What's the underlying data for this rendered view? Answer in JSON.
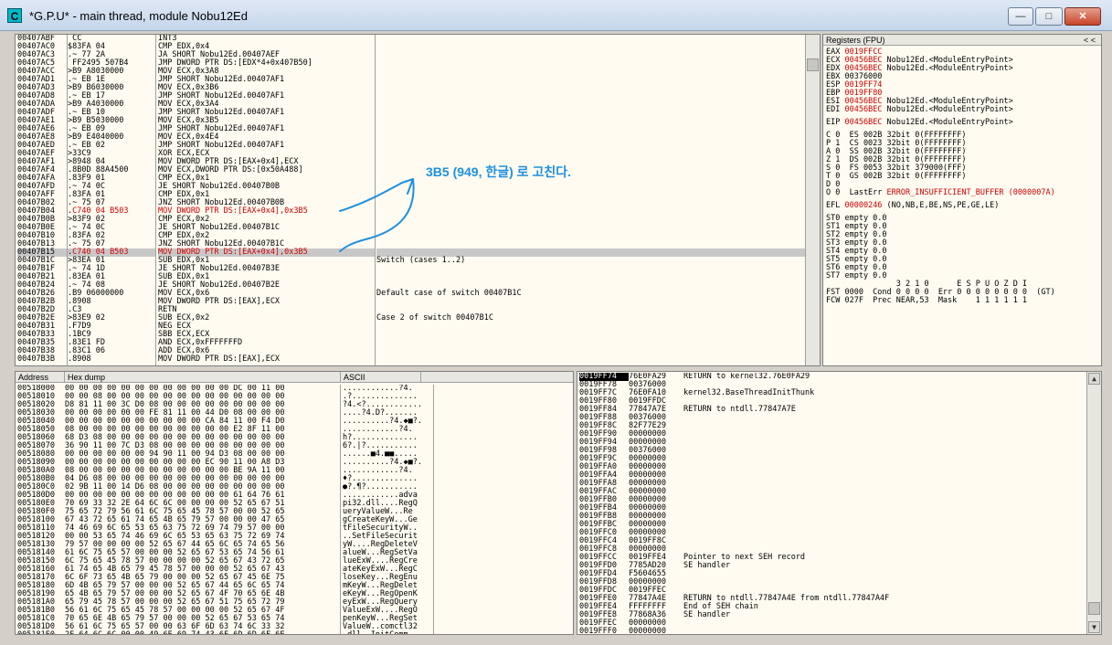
{
  "window": {
    "title": "*G.P.U* - main thread, module Nobu12Ed",
    "icon_letter": "C",
    "controls": {
      "minimize": "—",
      "maximize": "□",
      "close": "✕"
    }
  },
  "annotation": {
    "text": "3B5 (949, 한글) 로 고친다.",
    "color": "#1e90e0"
  },
  "cpu": {
    "selected_row": 26,
    "rows": [
      {
        "a": "00407ABF",
        "m": " ",
        "h": "CC",
        "i": "INT3",
        "c": ""
      },
      {
        "a": "00407AC0",
        "m": "$",
        "h": "83FA 04",
        "i": "CMP EDX,0x4",
        "c": ""
      },
      {
        "a": "00407AC3",
        "m": ".",
        "h": "~ 77 2A",
        "i": "JA SHORT Nobu12Ed.00407AEF",
        "c": ""
      },
      {
        "a": "00407AC5",
        "m": " ",
        "h": "FF2495 507B4",
        "i": "JMP DWORD PTR DS:[EDX*4+0x407B50]",
        "c": ""
      },
      {
        "a": "00407ACC",
        "m": ">",
        "h": "B9 A8030000",
        "i": "MOV ECX,0x3A8",
        "c": ""
      },
      {
        "a": "00407AD1",
        "m": ".",
        "h": "~ EB 1E",
        "i": "JMP SHORT Nobu12Ed.00407AF1",
        "c": ""
      },
      {
        "a": "00407AD3",
        "m": ">",
        "h": "B9 B6030000",
        "i": "MOV ECX,0x3B6",
        "c": ""
      },
      {
        "a": "00407AD8",
        "m": ".",
        "h": "~ EB 17",
        "i": "JMP SHORT Nobu12Ed.00407AF1",
        "c": ""
      },
      {
        "a": "00407ADA",
        "m": ">",
        "h": "B9 A4030000",
        "i": "MOV ECX,0x3A4",
        "c": ""
      },
      {
        "a": "00407ADF",
        "m": ".",
        "h": "~ EB 10",
        "i": "JMP SHORT Nobu12Ed.00407AF1",
        "c": ""
      },
      {
        "a": "00407AE1",
        "m": ">",
        "h": "B9 B5030000",
        "i": "MOV ECX,0x3B5",
        "c": ""
      },
      {
        "a": "00407AE6",
        "m": ".",
        "h": "~ EB 09",
        "i": "JMP SHORT Nobu12Ed.00407AF1",
        "c": ""
      },
      {
        "a": "00407AE8",
        "m": ">",
        "h": "B9 E4040000",
        "i": "MOV ECX,0x4E4",
        "c": ""
      },
      {
        "a": "00407AED",
        "m": ".",
        "h": "~ EB 02",
        "i": "JMP SHORT Nobu12Ed.00407AF1",
        "c": ""
      },
      {
        "a": "00407AEF",
        "m": ">",
        "h": "33C9",
        "i": "XOR ECX,ECX",
        "c": ""
      },
      {
        "a": "00407AF1",
        "m": ">",
        "h": "8948 04",
        "i": "MOV DWORD PTR DS:[EAX+0x4],ECX",
        "c": ""
      },
      {
        "a": "00407AF4",
        "m": ".",
        "h": "8B0D 88A4500",
        "i": "MOV ECX,DWORD PTR DS:[0x50A488]",
        "c": ""
      },
      {
        "a": "00407AFA",
        "m": ".",
        "h": "83F9 01",
        "i": "CMP ECX,0x1",
        "c": ""
      },
      {
        "a": "00407AFD",
        "m": ".",
        "h": "~ 74 0C",
        "i": "JE SHORT Nobu12Ed.00407B0B",
        "c": ""
      },
      {
        "a": "00407AFF",
        "m": ".",
        "h": "83FA 01",
        "i": "CMP EDX,0x1",
        "c": ""
      },
      {
        "a": "00407B02",
        "m": ".",
        "h": "~ 75 07",
        "i": "JNZ SHORT Nobu12Ed.00407B0B",
        "c": ""
      },
      {
        "a": "00407B04",
        "m": ".",
        "h": "C740 04 B503",
        "i": "MOV DWORD PTR DS:[EAX+0x4],0x3B5",
        "c": "",
        "red": true
      },
      {
        "a": "00407B0B",
        "m": ">",
        "h": "83F9 02",
        "i": "CMP ECX,0x2",
        "c": ""
      },
      {
        "a": "00407B0E",
        "m": ".",
        "h": "~ 74 0C",
        "i": "JE SHORT Nobu12Ed.00407B1C",
        "c": ""
      },
      {
        "a": "00407B10",
        "m": ".",
        "h": "83FA 02",
        "i": "CMP EDX,0x2",
        "c": ""
      },
      {
        "a": "00407B13",
        "m": ".",
        "h": "~ 75 07",
        "i": "JNZ SHORT Nobu12Ed.00407B1C",
        "c": ""
      },
      {
        "a": "00407B15",
        "m": ".",
        "h": "C740 04 B503",
        "i": "MOV DWORD PTR DS:[EAX+0x4],0x3B5",
        "c": "",
        "red": true
      },
      {
        "a": "00407B1C",
        "m": ">",
        "h": "83EA 01",
        "i": "SUB EDX,0x1",
        "c": "Switch (cases 1..2)"
      },
      {
        "a": "00407B1F",
        "m": ".",
        "h": "~ 74 1D",
        "i": "JE SHORT Nobu12Ed.00407B3E",
        "c": ""
      },
      {
        "a": "00407B21",
        "m": ".",
        "h": "83EA 01",
        "i": "SUB EDX,0x1",
        "c": ""
      },
      {
        "a": "00407B24",
        "m": ".",
        "h": "~ 74 08",
        "i": "JE SHORT Nobu12Ed.00407B2E",
        "c": ""
      },
      {
        "a": "00407B26",
        "m": ".",
        "h": "B9 06000000",
        "i": "MOV ECX,0x6",
        "c": "Default case of switch 00407B1C"
      },
      {
        "a": "00407B2B",
        "m": ".",
        "h": "8908",
        "i": "MOV DWORD PTR DS:[EAX],ECX",
        "c": ""
      },
      {
        "a": "00407B2D",
        "m": ".",
        "h": "C3",
        "i": "RETN",
        "c": ""
      },
      {
        "a": "00407B2E",
        "m": ">",
        "h": "83E9 02",
        "i": "SUB ECX,0x2",
        "c": "Case 2 of switch 00407B1C"
      },
      {
        "a": "00407B31",
        "m": ".",
        "h": "F7D9",
        "i": "NEG ECX",
        "c": ""
      },
      {
        "a": "00407B33",
        "m": ".",
        "h": "1BC9",
        "i": "SBB ECX,ECX",
        "c": ""
      },
      {
        "a": "00407B35",
        "m": ".",
        "h": "83E1 FD",
        "i": "AND ECX,0xFFFFFFFD",
        "c": ""
      },
      {
        "a": "00407B38",
        "m": ".",
        "h": "83C1 06",
        "i": "ADD ECX,0x6",
        "c": ""
      },
      {
        "a": "00407B3B",
        "m": ".",
        "h": "8908",
        "i": "MOV DWORD PTR DS:[EAX],ECX",
        "c": ""
      }
    ]
  },
  "registers": {
    "header": "Registers (FPU)",
    "nav": "<   <",
    "lines": [
      "EAX 0019FFCC",
      "ECX 00456BEC Nobu12Ed.<ModuleEntryPoint>",
      "EDX 00456BEC Nobu12Ed.<ModuleEntryPoint>",
      "EBX 00376000",
      "ESP 0019FF74",
      "EBP 0019FF80",
      "ESI 00456BEC Nobu12Ed.<ModuleEntryPoint>",
      "EDI 00456BEC Nobu12Ed.<ModuleEntryPoint>",
      "",
      "EIP 00456BEC Nobu12Ed.<ModuleEntryPoint>",
      "",
      "C 0  ES 002B 32bit 0(FFFFFFFF)",
      "P 1  CS 0023 32bit 0(FFFFFFFF)",
      "A 0  SS 002B 32bit 0(FFFFFFFF)",
      "Z 1  DS 002B 32bit 0(FFFFFFFF)",
      "S 0  FS 0053 32bit 379000(FFF)",
      "T 0  GS 002B 32bit 0(FFFFFFFF)",
      "D 0",
      "O 0  LastErr ERROR_INSUFFICIENT_BUFFER (0000007A)",
      "",
      "EFL 00000246 (NO,NB,E,BE,NS,PE,GE,LE)",
      "",
      "ST0 empty 0.0",
      "ST1 empty 0.0",
      "ST2 empty 0.0",
      "ST3 empty 0.0",
      "ST4 empty 0.0",
      "ST5 empty 0.0",
      "ST6 empty 0.0",
      "ST7 empty 0.0",
      "               3 2 1 0      E S P U O Z D I",
      "FST 0000  Cond 0 0 0 0  Err 0 0 0 0 0 0 0 0  (GT)",
      "FCW 027F  Prec NEAR,53  Mask    1 1 1 1 1 1"
    ]
  },
  "dump": {
    "headers": {
      "address": "Address",
      "hex": "Hex dump",
      "ascii": "ASCII"
    },
    "rows": [
      {
        "a": "00518000",
        "h": "00 00 00 00 00 00 00 00 00 00 00 00 DC 00 11 00",
        "s": "............?4."
      },
      {
        "a": "00518010",
        "h": "00 00 08 00 00 00 00 00 00 00 00 00 00 00 00 00",
        "s": ".?.............."
      },
      {
        "a": "00518020",
        "h": "D8 81 11 00 3C D0 08 00 00 00 00 00 00 00 00 00",
        "s": "?4.<?............"
      },
      {
        "a": "00518030",
        "h": "00 00 00 00 00 00 FE 81 11 00 44 D0 08 00 00 00",
        "s": "....?4.D?......."
      },
      {
        "a": "00518040",
        "h": "00 00 00 00 00 00 00 00 00 00 CA 84 11 00 F4 D0",
        "s": "..........?4.◆■?."
      },
      {
        "a": "00518050",
        "h": "08 00 00 00 00 00 00 00 00 00 00 00 E2 8F 11 00",
        "s": "............?4."
      },
      {
        "a": "00518060",
        "h": "68 D3 08 00 00 00 00 00 00 00 00 00 00 00 00 00",
        "s": "h?.............."
      },
      {
        "a": "00518070",
        "h": "36 90 11 00 7C D3 08 00 00 00 00 00 00 00 00 00",
        "s": "6?.|?..........."
      },
      {
        "a": "00518080",
        "h": "00 00 00 00 00 00 94 90 11 00 94 D3 08 00 00 00",
        "s": "......■4.■■....."
      },
      {
        "a": "00518090",
        "h": "00 00 00 00 00 00 00 00 00 00 EC 90 11 00 A8 D3",
        "s": "..........?4.◆■?."
      },
      {
        "a": "005180A0",
        "h": "08 00 00 00 00 00 00 00 00 00 00 00 BE 9A 11 00",
        "s": "............?4."
      },
      {
        "a": "005180B0",
        "h": "04 D6 08 00 00 00 00 00 00 00 00 00 00 00 00 00",
        "s": "♦?.............."
      },
      {
        "a": "005180C0",
        "h": "02 9B 11 00 14 D6 08 00 00 00 00 00 00 00 00 00",
        "s": "●?.¶?..........."
      },
      {
        "a": "005180D0",
        "h": "00 00 00 00 00 00 00 00 00 00 00 00 61 64 76 61",
        "s": "............adva"
      },
      {
        "a": "005180E0",
        "h": "70 69 33 32 2E 64 6C 6C 00 00 00 00 52 65 67 51",
        "s": "pi32.dll....RegQ"
      },
      {
        "a": "005180F0",
        "h": "75 65 72 79 56 61 6C 75 65 45 78 57 00 00 52 65",
        "s": "ueryValueW...Re"
      },
      {
        "a": "00518100",
        "h": "67 43 72 65 61 74 65 4B 65 79 57 00 00 00 47 65",
        "s": "gCreateKeyW...Ge"
      },
      {
        "a": "00518110",
        "h": "74 46 69 6C 65 53 65 63 75 72 69 74 79 57 00 00",
        "s": "tFileSecurityW.."
      },
      {
        "a": "00518120",
        "h": "00 00 53 65 74 46 69 6C 65 53 65 63 75 72 69 74",
        "s": "..SetFileSecurit"
      },
      {
        "a": "00518130",
        "h": "79 57 00 00 00 00 52 65 67 44 65 6C 65 74 65 56",
        "s": "yW....RegDeleteV"
      },
      {
        "a": "00518140",
        "h": "61 6C 75 65 57 00 00 00 52 65 67 53 65 74 56 61",
        "s": "alueW...RegSetVa"
      },
      {
        "a": "00518150",
        "h": "6C 75 65 45 78 57 00 00 00 00 52 65 67 43 72 65",
        "s": "lueExW....RegCre"
      },
      {
        "a": "00518160",
        "h": "61 74 65 4B 65 79 45 78 57 00 00 00 52 65 67 43",
        "s": "ateKeyExW...RegC"
      },
      {
        "a": "00518170",
        "h": "6C 6F 73 65 4B 65 79 00 00 00 52 65 67 45 6E 75",
        "s": "loseKey...RegEnu"
      },
      {
        "a": "00518180",
        "h": "6D 4B 65 79 57 00 00 00 52 65 67 44 65 6C 65 74",
        "s": "mKeyW...RegDelet"
      },
      {
        "a": "00518190",
        "h": "65 4B 65 79 57 00 00 00 52 65 67 4F 70 65 6E 4B",
        "s": "eKeyW...RegOpenK"
      },
      {
        "a": "005181A0",
        "h": "65 79 45 78 57 00 00 00 52 65 67 51 75 65 72 79",
        "s": "eyExW...RegQuery"
      },
      {
        "a": "005181B0",
        "h": "56 61 6C 75 65 45 78 57 00 00 00 00 52 65 67 4F",
        "s": "ValueExW....RegO"
      },
      {
        "a": "005181C0",
        "h": "70 65 6E 4B 65 79 57 00 00 00 52 65 67 53 65 74",
        "s": "penKeyW...RegSet"
      },
      {
        "a": "005181D0",
        "h": "56 61 6C 75 65 57 00 00 63 6F 6D 63 74 6C 33 32",
        "s": "ValueW..comctl32"
      },
      {
        "a": "005181E0",
        "h": "2E 64 6C 6C 00 00 49 6E 69 74 43 6F 6D 6D 6F 6E",
        "s": ".dll..InitComm"
      }
    ]
  },
  "stack": {
    "selected_row": 0,
    "rows": [
      {
        "a": "0019FF74",
        "v": "76E0FA29",
        "c": "RETURN to kernel32.76E0FA29"
      },
      {
        "a": "0019FF78",
        "v": "00376000",
        "c": ""
      },
      {
        "a": "0019FF7C",
        "v": "76E0FA10",
        "c": "kernel32.BaseThreadInitThunk"
      },
      {
        "a": "0019FF80",
        "v": "0019FFDC",
        "c": ""
      },
      {
        "a": "0019FF84",
        "v": "77847A7E",
        "c": "RETURN to ntdll.77847A7E"
      },
      {
        "a": "0019FF88",
        "v": "00376000",
        "c": ""
      },
      {
        "a": "0019FF8C",
        "v": "82F77E29",
        "c": ""
      },
      {
        "a": "0019FF90",
        "v": "00000000",
        "c": ""
      },
      {
        "a": "0019FF94",
        "v": "00000000",
        "c": ""
      },
      {
        "a": "0019FF98",
        "v": "00376000",
        "c": ""
      },
      {
        "a": "0019FF9C",
        "v": "00000000",
        "c": ""
      },
      {
        "a": "0019FFA0",
        "v": "00000000",
        "c": ""
      },
      {
        "a": "0019FFA4",
        "v": "00000000",
        "c": ""
      },
      {
        "a": "0019FFA8",
        "v": "00000000",
        "c": ""
      },
      {
        "a": "0019FFAC",
        "v": "00000000",
        "c": ""
      },
      {
        "a": "0019FFB0",
        "v": "00000000",
        "c": ""
      },
      {
        "a": "0019FFB4",
        "v": "00000000",
        "c": ""
      },
      {
        "a": "0019FFB8",
        "v": "00000000",
        "c": ""
      },
      {
        "a": "0019FFBC",
        "v": "00000000",
        "c": ""
      },
      {
        "a": "0019FFC0",
        "v": "00000000",
        "c": ""
      },
      {
        "a": "0019FFC4",
        "v": "0019FF8C",
        "c": ""
      },
      {
        "a": "0019FFC8",
        "v": "00000000",
        "c": ""
      },
      {
        "a": "0019FFCC",
        "v": "0019FFE4",
        "c": "Pointer to next SEH record"
      },
      {
        "a": "0019FFD0",
        "v": "7785AD20",
        "c": "SE handler"
      },
      {
        "a": "0019FFD4",
        "v": "F5604655",
        "c": ""
      },
      {
        "a": "0019FFD8",
        "v": "00000000",
        "c": ""
      },
      {
        "a": "0019FFDC",
        "v": "0019FFEC",
        "c": ""
      },
      {
        "a": "0019FFE0",
        "v": "77847A4E",
        "c": "RETURN to ntdll.77847A4E from ntdll.77847A4F"
      },
      {
        "a": "0019FFE4",
        "v": "FFFFFFFF",
        "c": "End of SEH chain"
      },
      {
        "a": "0019FFE8",
        "v": "77868A36",
        "c": "SE handler"
      },
      {
        "a": "0019FFEC",
        "v": "00000000",
        "c": ""
      },
      {
        "a": "0019FFF0",
        "v": "00000000",
        "c": ""
      }
    ]
  }
}
